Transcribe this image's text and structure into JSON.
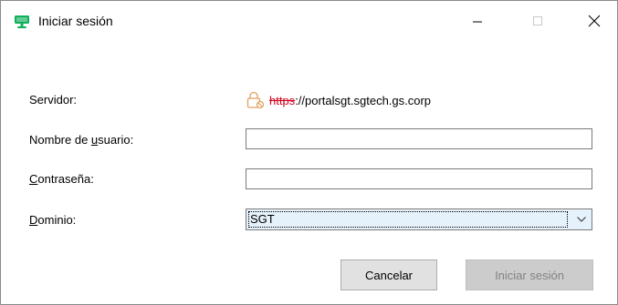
{
  "window": {
    "title": "Iniciar sesión",
    "icon": "remote-desktop-icon"
  },
  "form": {
    "server_label": "Servidor:",
    "server_value": {
      "scheme": "https",
      "rest": "://portalsgt.sgtech.gs.corp",
      "icon": "broken-lock-icon",
      "scheme_color": "#d0021b"
    },
    "user_label_before": "Nombre de ",
    "user_label_accel": "u",
    "user_label_after": "suario:",
    "user_value": "",
    "pass_label_accel": "C",
    "pass_label_after": "ontraseña:",
    "pass_value": "",
    "domain_label_accel": "D",
    "domain_label_after": "ominio:",
    "domain_value": "SGT"
  },
  "buttons": {
    "cancel": "Cancelar",
    "login": "Iniciar sesión"
  },
  "colors": {
    "accent_icon": "#10b05b",
    "disabled_text": "#838383",
    "select_bg": "#e5f1fb"
  }
}
